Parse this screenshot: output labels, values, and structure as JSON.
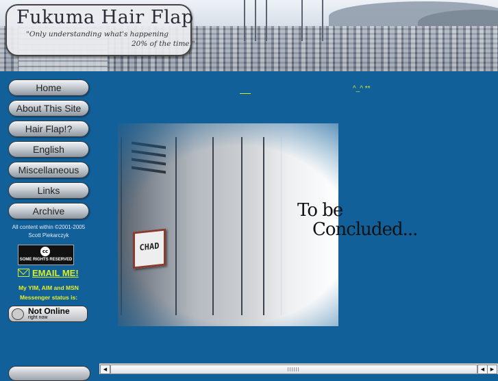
{
  "banner": {
    "title": "Fukuma Hair Flap",
    "tagline_line1": "\"Only understanding what's happening",
    "tagline_line2": "20% of the time.\""
  },
  "nav": {
    "items": [
      "Home",
      "About This Site",
      "Hair Flap!?",
      "English",
      "Miscellaneous",
      "Links",
      "Archive"
    ]
  },
  "sidebar": {
    "copyright_line1": "All content within ©2001-2005",
    "copyright_line2": "Scott Piekarczyk",
    "cc_symbol": "cc",
    "cc_label": "SOME RIGHTS RESERVED",
    "email_label": "EMAIL ME!",
    "status_label_line1": "My YIM, AIM and MSN",
    "status_label_line2": "Messenger status is:",
    "status_main": "Not Online",
    "status_sub": "right now"
  },
  "content": {
    "link_right": "^_^ **",
    "photo": {
      "nameplate": "CHAD",
      "caption_line1": "To be",
      "caption_line2": "Concluded..."
    }
  },
  "scrollbar": {
    "left_arrow": "◀",
    "right_arrow": "▶",
    "right_arrow_2": "◀"
  }
}
